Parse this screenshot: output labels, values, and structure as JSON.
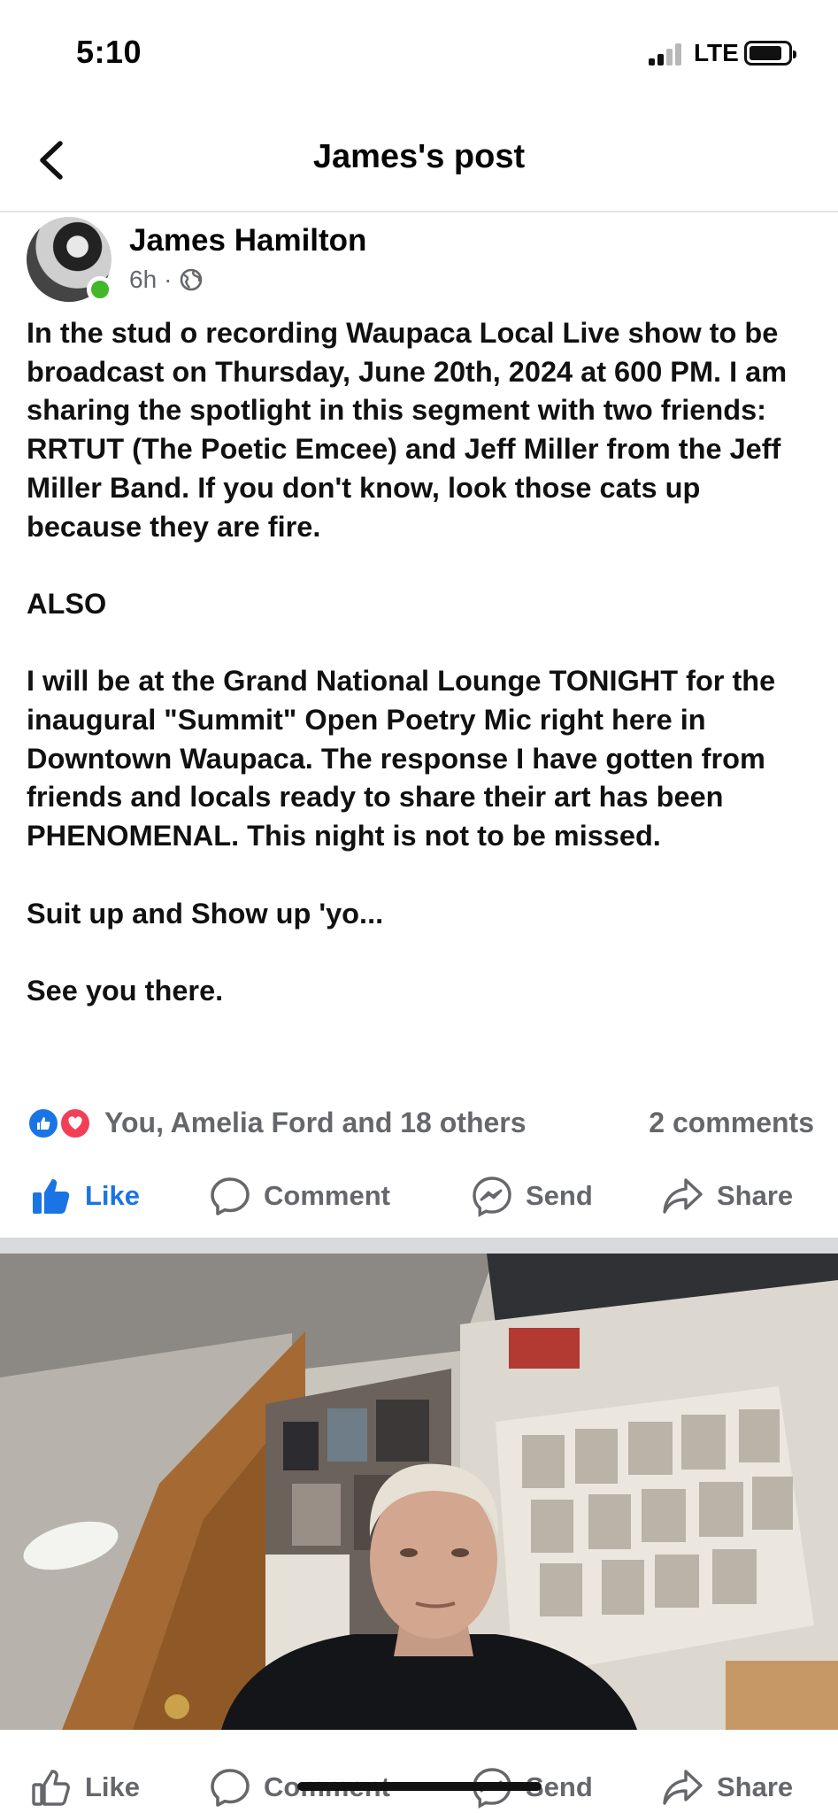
{
  "status": {
    "time": "5:10",
    "network": "LTE"
  },
  "header": {
    "title": "James's post"
  },
  "post": {
    "author": "James Hamilton",
    "time_ago": "6h",
    "text": "In the stud o recording Waupaca Local Live show to be broadcast on Thursday, June 20th, 2024 at 600 PM. I am sharing the spotlight in this segment with two friends: RRTUT (The Poetic Emcee) and Jeff Miller from the Jeff Miller Band. If you don't know, look those cats up because they are fire.\n\nALSO\n\nI will be at the Grand National Lounge TONIGHT for the inaugural \"Summit\" Open Poetry Mic right here in Downtown Waupaca. The response I have gotten from friends and locals ready to share their art has been PHENOMENAL. This night is not to be missed.\n\nSuit up and Show up 'yo...\n\nSee you there."
  },
  "reactions": {
    "names": "You, Amelia Ford and 18 others",
    "comments": "2 comments"
  },
  "actions": {
    "like": "Like",
    "comment": "Comment",
    "send": "Send",
    "share": "Share"
  },
  "colors": {
    "like_blue": "#1b74e4",
    "love_red": "#f33e58",
    "online_green": "#42b72a",
    "secondary_text": "#65676b"
  }
}
